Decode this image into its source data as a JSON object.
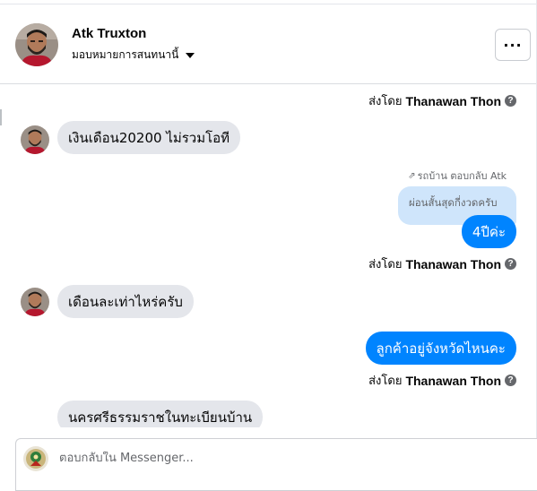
{
  "header": {
    "name": "Atk Truxton",
    "subtitle": "มอบหมายการสนทนานี้",
    "more_label": "···"
  },
  "thread": {
    "sent_by_prefix": "ส่งโดย",
    "agent_name": "Thanawan Thon",
    "help_glyph": "?",
    "reply_label": "รถบ้าน ตอบกลับ Atk",
    "quoted_text": "ผ่อนสั้นสุดกี่งวดครับ",
    "messages": [
      {
        "text": "เงินเดือน20200 ไม่รวมโอที"
      },
      {
        "text": "4ปีค่ะ"
      },
      {
        "text": "เดือนละเท่าไหร่ครับ"
      },
      {
        "text": "ลูกค้าอยู่จังหวัดไหนคะ"
      },
      {
        "text": "นครศรีธรรมราชในทะเบียนบ้าน"
      }
    ]
  },
  "composer": {
    "placeholder": "ตอบกลับใน Messenger..."
  },
  "colors": {
    "outgoing_bubble": "#0084ff",
    "incoming_bubble": "#e4e6eb",
    "quoted_bubble": "#cfe5fb"
  }
}
